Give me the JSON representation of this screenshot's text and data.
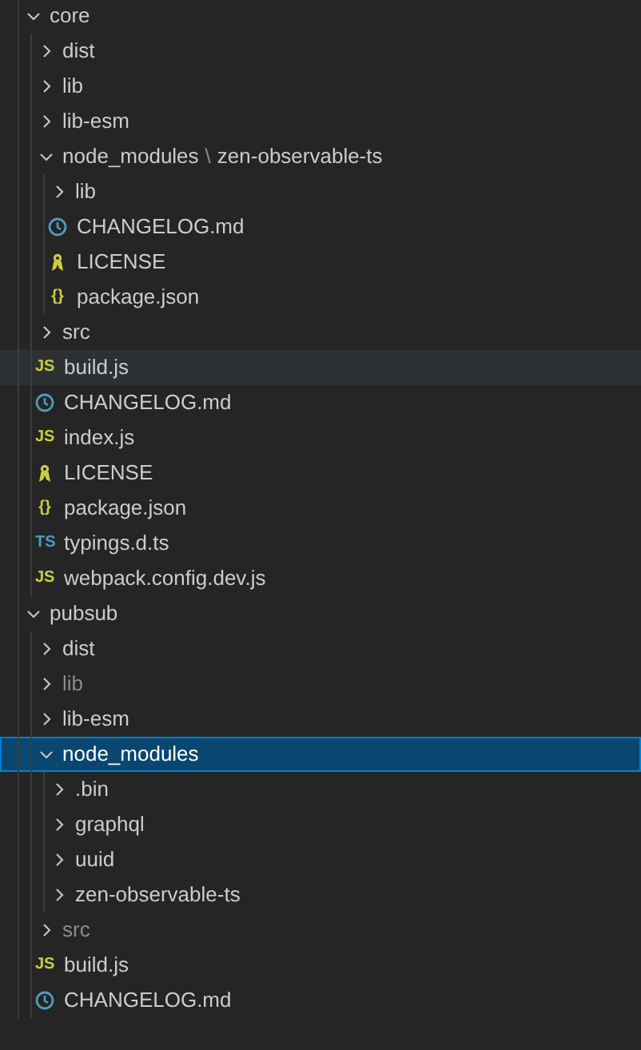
{
  "tree": [
    {
      "kind": "folder",
      "name": "core",
      "expanded": true,
      "selected": false,
      "hovered": false,
      "dimmed": false,
      "children": [
        {
          "kind": "folder",
          "name": "dist",
          "expanded": false,
          "selected": false,
          "hovered": false,
          "dimmed": false
        },
        {
          "kind": "folder",
          "name": "lib",
          "expanded": false,
          "selected": false,
          "hovered": false,
          "dimmed": false
        },
        {
          "kind": "folder",
          "name": "lib-esm",
          "expanded": false,
          "selected": false,
          "hovered": false,
          "dimmed": false
        },
        {
          "kind": "folder",
          "name": "node_modules",
          "separator": "\\",
          "compact_child": "zen-observable-ts",
          "expanded": true,
          "selected": false,
          "hovered": false,
          "dimmed": false,
          "children": [
            {
              "kind": "folder",
              "name": "lib",
              "expanded": false,
              "selected": false,
              "hovered": false,
              "dimmed": false
            },
            {
              "kind": "md",
              "name": "CHANGELOG.md",
              "selected": false,
              "hovered": false,
              "dimmed": false
            },
            {
              "kind": "license",
              "name": "LICENSE",
              "selected": false,
              "hovered": false,
              "dimmed": false
            },
            {
              "kind": "json",
              "glyph": "{}",
              "name": "package.json",
              "selected": false,
              "hovered": false,
              "dimmed": false
            }
          ]
        },
        {
          "kind": "folder",
          "name": "src",
          "expanded": false,
          "selected": false,
          "hovered": false,
          "dimmed": false
        },
        {
          "kind": "js",
          "glyph": "JS",
          "name": "build.js",
          "selected": false,
          "hovered": true,
          "dimmed": false
        },
        {
          "kind": "md",
          "name": "CHANGELOG.md",
          "selected": false,
          "hovered": false,
          "dimmed": false
        },
        {
          "kind": "js",
          "glyph": "JS",
          "name": "index.js",
          "selected": false,
          "hovered": false,
          "dimmed": false
        },
        {
          "kind": "license",
          "name": "LICENSE",
          "selected": false,
          "hovered": false,
          "dimmed": false
        },
        {
          "kind": "json",
          "glyph": "{}",
          "name": "package.json",
          "selected": false,
          "hovered": false,
          "dimmed": false
        },
        {
          "kind": "ts",
          "glyph": "TS",
          "name": "typings.d.ts",
          "selected": false,
          "hovered": false,
          "dimmed": false
        },
        {
          "kind": "js",
          "glyph": "JS",
          "name": "webpack.config.dev.js",
          "selected": false,
          "hovered": false,
          "dimmed": false
        }
      ]
    },
    {
      "kind": "folder",
      "name": "pubsub",
      "expanded": true,
      "selected": false,
      "hovered": false,
      "dimmed": false,
      "children": [
        {
          "kind": "folder",
          "name": "dist",
          "expanded": false,
          "selected": false,
          "hovered": false,
          "dimmed": false
        },
        {
          "kind": "folder",
          "name": "lib",
          "expanded": false,
          "selected": false,
          "hovered": false,
          "dimmed": true
        },
        {
          "kind": "folder",
          "name": "lib-esm",
          "expanded": false,
          "selected": false,
          "hovered": false,
          "dimmed": false
        },
        {
          "kind": "folder",
          "name": "node_modules",
          "expanded": true,
          "selected": true,
          "hovered": false,
          "dimmed": false,
          "children": [
            {
              "kind": "folder",
              "name": ".bin",
              "expanded": false,
              "selected": false,
              "hovered": false,
              "dimmed": false
            },
            {
              "kind": "folder",
              "name": "graphql",
              "expanded": false,
              "selected": false,
              "hovered": false,
              "dimmed": false
            },
            {
              "kind": "folder",
              "name": "uuid",
              "expanded": false,
              "selected": false,
              "hovered": false,
              "dimmed": false
            },
            {
              "kind": "folder",
              "name": "zen-observable-ts",
              "expanded": false,
              "selected": false,
              "hovered": false,
              "dimmed": false
            }
          ]
        },
        {
          "kind": "folder",
          "name": "src",
          "expanded": false,
          "selected": false,
          "hovered": false,
          "dimmed": true
        },
        {
          "kind": "js",
          "glyph": "JS",
          "name": "build.js",
          "selected": false,
          "hovered": false,
          "dimmed": false
        },
        {
          "kind": "md",
          "name": "CHANGELOG.md",
          "selected": false,
          "hovered": false,
          "dimmed": false
        }
      ]
    }
  ]
}
